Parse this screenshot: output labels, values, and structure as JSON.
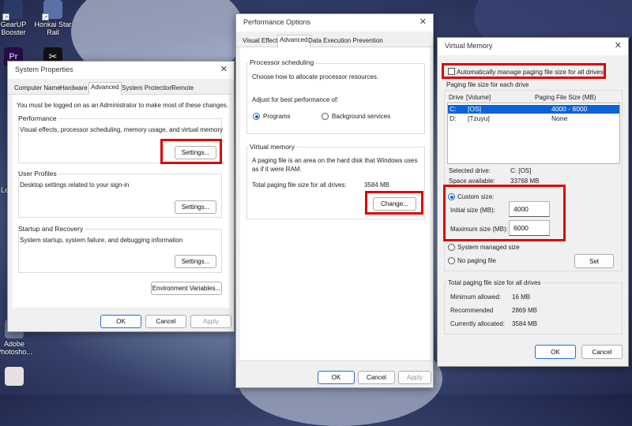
{
  "desktop": {
    "icons": [
      {
        "label": "GearUP Booster"
      },
      {
        "label": "Honkai Star Rail"
      },
      {
        "label": "Pr"
      },
      {
        "label": "Le"
      },
      {
        "label": "Adobe Photosho..."
      }
    ]
  },
  "system_properties": {
    "title": "System Properties",
    "tabs": [
      "Computer Name",
      "Hardware",
      "Advanced",
      "System Protection",
      "Remote"
    ],
    "admin_note": "You must be logged on as an Administrator to make most of these changes.",
    "performance": {
      "label": "Performance",
      "desc": "Visual effects, processor scheduling, memory usage, and virtual memory",
      "button": "Settings..."
    },
    "user_profiles": {
      "label": "User Profiles",
      "desc": "Desktop settings related to your sign-in",
      "button": "Settings..."
    },
    "startup": {
      "label": "Startup and Recovery",
      "desc": "System startup, system failure, and debugging information",
      "button": "Settings..."
    },
    "env_button": "Environment Variables...",
    "ok": "OK",
    "cancel": "Cancel",
    "apply": "Apply"
  },
  "performance_options": {
    "title": "Performance Options",
    "tabs": [
      "Visual Effects",
      "Advanced",
      "Data Execution Prevention"
    ],
    "processor": {
      "label": "Processor scheduling",
      "desc": "Choose how to allocate processor resources.",
      "adjust": "Adjust for best performance of:",
      "programs": "Programs",
      "background": "Background services"
    },
    "virtual_memory": {
      "label": "Virtual memory",
      "desc_line1": "A paging file is an area on the hard disk that Windows uses",
      "desc_line2": "as if it were RAM.",
      "total_label": "Total paging file size for all drives:",
      "total_value": "3584 MB",
      "change_button": "Change..."
    },
    "ok": "OK",
    "cancel": "Cancel",
    "apply": "Apply"
  },
  "virtual_memory": {
    "title": "Virtual Memory",
    "auto_manage": "Automatically manage paging file size for all drives",
    "per_drive_label": "Paging file size for each drive",
    "col_drive": "Drive",
    "col_volume": "[Volume]",
    "col_size": "Paging File Size (MB)",
    "drives": [
      {
        "drive": "C:",
        "volume": "[OS]",
        "size": "4000 - 6000"
      },
      {
        "drive": "D:",
        "volume": "[Tzuyu]",
        "size": "None"
      }
    ],
    "selected_drive_label": "Selected drive:",
    "selected_drive_value": "C:  [OS]",
    "space_label": "Space available:",
    "space_value": "33768 MB",
    "custom_size": "Custom size:",
    "initial_label": "Initial size (MB):",
    "initial_value": "4000",
    "max_label": "Maximum size (MB):",
    "max_value": "6000",
    "system_managed": "System managed size",
    "no_paging": "No paging file",
    "set_button": "Set",
    "totals_label": "Total paging file size for all drives",
    "min_label": "Minimum allowed:",
    "min_value": "16 MB",
    "rec_label": "Recommended",
    "rec_value": "2869 MB",
    "cur_label": "Currently allocated:",
    "cur_value": "3584 MB",
    "ok": "OK",
    "cancel": "Cancel"
  },
  "colors": {
    "highlight": "#e00000",
    "selection": "#0a64d8",
    "accent": "#1e63c7"
  }
}
